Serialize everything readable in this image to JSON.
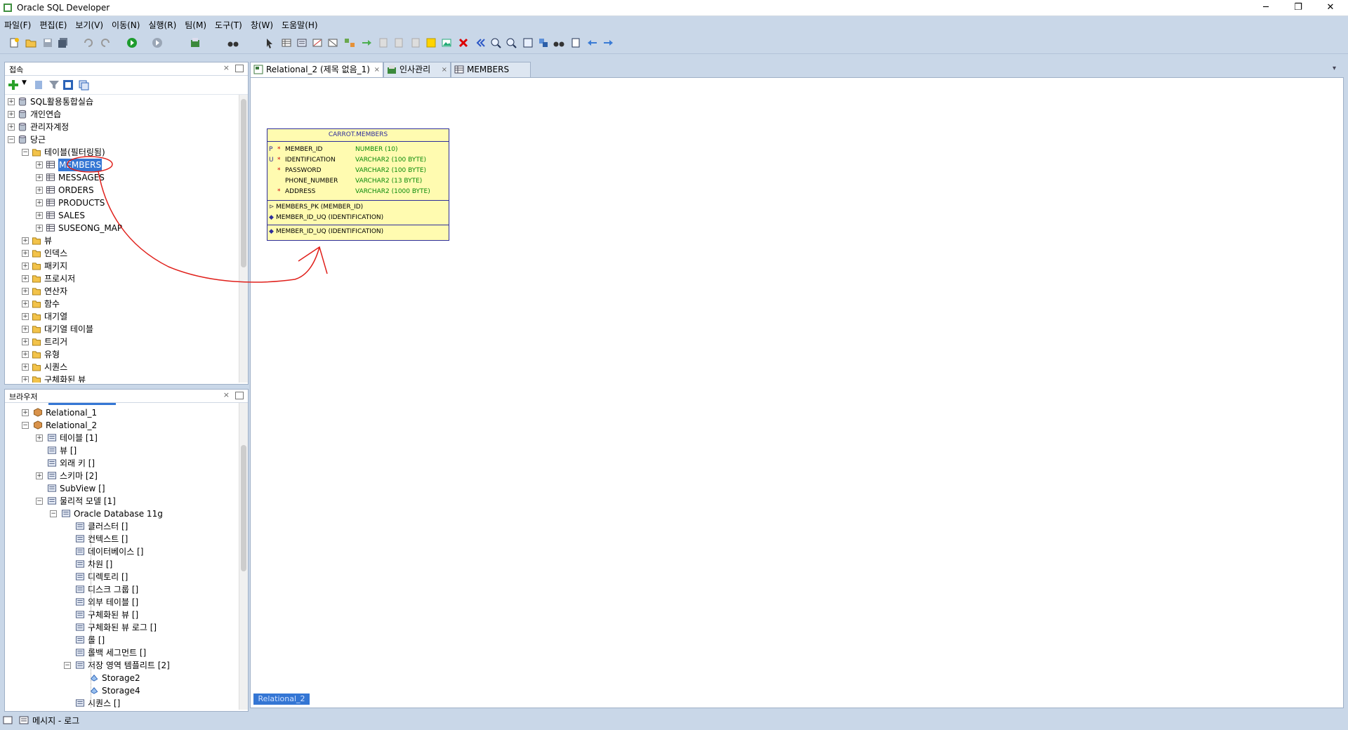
{
  "window": {
    "title": "Oracle SQL Developer",
    "controls": [
      "─",
      "❐",
      "✕"
    ]
  },
  "menu": [
    "파일(F)",
    "편집(E)",
    "보기(V)",
    "이동(N)",
    "실행(R)",
    "팀(M)",
    "도구(T)",
    "창(W)",
    "도움말(H)"
  ],
  "connections_panel": {
    "title": "접속",
    "tree": [
      {
        "label": "SQL활용통합실습",
        "level": 0,
        "expanded": false
      },
      {
        "label": "개인연습",
        "level": 0,
        "expanded": false
      },
      {
        "label": "관리자계정",
        "level": 0,
        "expanded": false
      },
      {
        "label": "당근",
        "level": 0,
        "expanded": true
      },
      {
        "label": "테이블(필터링됨)",
        "level": 1,
        "expanded": true
      },
      {
        "label": "MEMBERS",
        "level": 2,
        "expanded": false,
        "selected": true
      },
      {
        "label": "MESSAGES",
        "level": 2,
        "expanded": false
      },
      {
        "label": "ORDERS",
        "level": 2,
        "expanded": false
      },
      {
        "label": "PRODUCTS",
        "level": 2,
        "expanded": false
      },
      {
        "label": "SALES",
        "level": 2,
        "expanded": false
      },
      {
        "label": "SUSEONG_MAP",
        "level": 2,
        "expanded": false
      },
      {
        "label": "뷰",
        "level": 1,
        "expanded": false
      },
      {
        "label": "인덱스",
        "level": 1,
        "expanded": false
      },
      {
        "label": "패키지",
        "level": 1,
        "expanded": false
      },
      {
        "label": "프로시저",
        "level": 1,
        "expanded": false
      },
      {
        "label": "연산자",
        "level": 1,
        "expanded": false
      },
      {
        "label": "함수",
        "level": 1,
        "expanded": false
      },
      {
        "label": "대기열",
        "level": 1,
        "expanded": false
      },
      {
        "label": "대기열 테이블",
        "level": 1,
        "expanded": false
      },
      {
        "label": "트리거",
        "level": 1,
        "expanded": false
      },
      {
        "label": "유형",
        "level": 1,
        "expanded": false
      },
      {
        "label": "시퀀스",
        "level": 1,
        "expanded": false
      },
      {
        "label": "구체화된 뷰",
        "level": 1,
        "expanded": false
      }
    ]
  },
  "browser_panel": {
    "title": "브라우저",
    "tree": [
      {
        "label": "Relational_1",
        "level": 2,
        "expander": "+"
      },
      {
        "label": "Relational_2",
        "level": 2,
        "expander": "-"
      },
      {
        "label": "테이블 [1]",
        "level": 3,
        "expander": "+"
      },
      {
        "label": "뷰 []",
        "level": 3,
        "expander": ""
      },
      {
        "label": "외래 키 []",
        "level": 3,
        "expander": ""
      },
      {
        "label": "스키마 [2]",
        "level": 3,
        "expander": "+"
      },
      {
        "label": "SubView []",
        "level": 3,
        "expander": ""
      },
      {
        "label": "물리적 모델 [1]",
        "level": 3,
        "expander": "-"
      },
      {
        "label": "Oracle Database 11g",
        "level": 4,
        "expander": "-"
      },
      {
        "label": "클러스터 []",
        "level": 5,
        "expander": ""
      },
      {
        "label": "컨텍스트 []",
        "level": 5,
        "expander": ""
      },
      {
        "label": "데이터베이스 []",
        "level": 5,
        "expander": ""
      },
      {
        "label": "차원 []",
        "level": 5,
        "expander": ""
      },
      {
        "label": "디렉토리 []",
        "level": 5,
        "expander": ""
      },
      {
        "label": "디스크 그룹 []",
        "level": 5,
        "expander": ""
      },
      {
        "label": "외부 테이블 []",
        "level": 5,
        "expander": ""
      },
      {
        "label": "구체화된 뷰 []",
        "level": 5,
        "expander": ""
      },
      {
        "label": "구체화된 뷰 로그 []",
        "level": 5,
        "expander": ""
      },
      {
        "label": "롤 []",
        "level": 5,
        "expander": ""
      },
      {
        "label": "롤백 세그먼트 []",
        "level": 5,
        "expander": ""
      },
      {
        "label": "저장 영역 템플리트 [2]",
        "level": 5,
        "expander": "-"
      },
      {
        "label": "Storage2",
        "level": 6,
        "expander": ""
      },
      {
        "label": "Storage4",
        "level": 6,
        "expander": ""
      },
      {
        "label": "시퀀스 []",
        "level": 5,
        "expander": ""
      }
    ]
  },
  "editor_tabs": [
    {
      "label": "Relational_2 (제목 없음_1)",
      "close": "×",
      "active": true
    },
    {
      "label": "인사관리",
      "close": "×",
      "active": false
    },
    {
      "label": "MEMBERS",
      "close": "",
      "active": false
    }
  ],
  "entity": {
    "name": "CARROT.MEMBERS",
    "columns": [
      {
        "key": "P",
        "mandatory": "*",
        "name": "MEMBER_ID",
        "type": "NUMBER (10)"
      },
      {
        "key": "U",
        "mandatory": "*",
        "name": "IDENTIFICATION",
        "type": "VARCHAR2 (100 BYTE)"
      },
      {
        "key": "",
        "mandatory": "*",
        "name": "PASSWORD",
        "type": "VARCHAR2 (100 BYTE)"
      },
      {
        "key": "",
        "mandatory": "",
        "name": "PHONE_NUMBER",
        "type": "VARCHAR2 (13 BYTE)"
      },
      {
        "key": "",
        "mandatory": "*",
        "name": "ADDRESS",
        "type": "VARCHAR2 (1000 BYTE)"
      }
    ],
    "keys": [
      "MEMBERS_PK (MEMBER_ID)",
      "MEMBER_ID_UQ (IDENTIFICATION)"
    ],
    "indexes": [
      "MEMBER_ID_UQ (IDENTIFICATION)"
    ]
  },
  "bottom_tab": "Relational_2",
  "status": "메시지 - 로그",
  "colors": {
    "accent": "#3476d4",
    "annotation": "#e0201b",
    "entity_fill": "#fffbb0",
    "entity_border": "#2d2d9a"
  }
}
